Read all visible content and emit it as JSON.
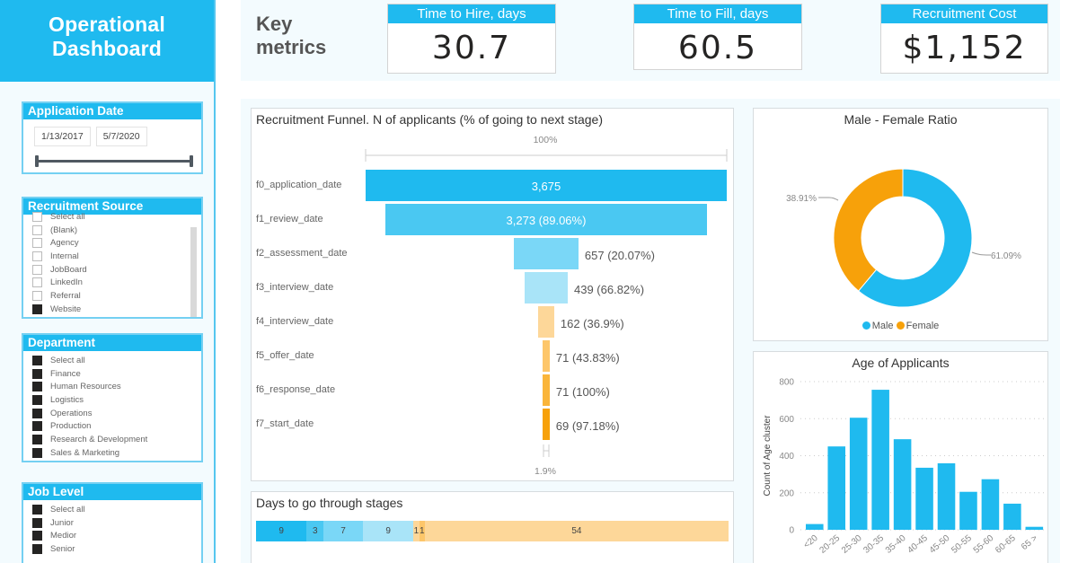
{
  "sidebar": {
    "title_line1": "Operational",
    "title_line2": "Dashboard",
    "application_date": {
      "header": "Application Date",
      "start": "1/13/2017",
      "end": "5/7/2020"
    },
    "recruitment_source": {
      "header": "Recruitment Source",
      "items": [
        {
          "label": "Select all",
          "checked": false
        },
        {
          "label": "(Blank)",
          "checked": false
        },
        {
          "label": "Agency",
          "checked": false
        },
        {
          "label": "Internal",
          "checked": false
        },
        {
          "label": "JobBoard",
          "checked": false
        },
        {
          "label": "LinkedIn",
          "checked": false
        },
        {
          "label": "Referral",
          "checked": false
        },
        {
          "label": "Website",
          "checked": true
        }
      ]
    },
    "department": {
      "header": "Department",
      "items": [
        {
          "label": "Select all",
          "checked": true
        },
        {
          "label": "Finance",
          "checked": true
        },
        {
          "label": "Human Resources",
          "checked": true
        },
        {
          "label": "Logistics",
          "checked": true
        },
        {
          "label": "Operations",
          "checked": true
        },
        {
          "label": "Production",
          "checked": true
        },
        {
          "label": "Research & Development",
          "checked": true
        },
        {
          "label": "Sales & Marketing",
          "checked": true
        }
      ]
    },
    "job_level": {
      "header": "Job Level",
      "items": [
        {
          "label": "Select all",
          "checked": true
        },
        {
          "label": "Junior",
          "checked": true
        },
        {
          "label": "Medior",
          "checked": true
        },
        {
          "label": "Senior",
          "checked": true
        }
      ]
    }
  },
  "key_metrics": {
    "label_line1": "Key",
    "label_line2": "metrics",
    "cards": [
      {
        "title": "Time to Hire, days",
        "value": "30.7"
      },
      {
        "title": "Time to Fill, days",
        "value": "60.5"
      },
      {
        "title": "Recruitment Cost",
        "value": "$1,152"
      }
    ]
  },
  "colors": {
    "accent": "#1fbaef",
    "female": "#f7a10a",
    "funnel": [
      "#1fbaef",
      "#4ac8f2",
      "#7ad7f7",
      "#a9e4f8",
      "#fdd799",
      "#fdc66a",
      "#fab53a",
      "#f7a10a"
    ]
  },
  "chart_data": [
    {
      "type": "bar",
      "subtype": "funnel",
      "title": "Recruitment Funnel. N of applicants (% of going to next stage)",
      "top_axis_label": "100%",
      "bottom_axis_label": "1.9%",
      "categories": [
        "f0_application_date",
        "f1_review_date",
        "f2_assessment_date",
        "f3_interview_date",
        "f4_interview_date",
        "f5_offer_date",
        "f6_response_date",
        "f7_start_date"
      ],
      "values": [
        3675,
        3273,
        657,
        439,
        162,
        71,
        71,
        69
      ],
      "data_labels": [
        "3,675",
        "3,273 (89.06%)",
        "657 (20.07%)",
        "439 (66.82%)",
        "162 (36.9%)",
        "71 (43.83%)",
        "71 (100%)",
        "69 (97.18%)"
      ]
    },
    {
      "type": "bar",
      "subtype": "stacked-100",
      "title": "Days to go through stages",
      "values": [
        9,
        3,
        7,
        9,
        1,
        1,
        54
      ],
      "data_labels": [
        "9",
        "3",
        "7",
        "9",
        "1",
        "1",
        "54"
      ]
    },
    {
      "type": "pie",
      "subtype": "donut",
      "title": "Male - Female Ratio",
      "categories": [
        "Male",
        "Female"
      ],
      "values": [
        61.09,
        38.91
      ],
      "data_labels": [
        "61.09%",
        "38.91%"
      ],
      "legend": "bottom"
    },
    {
      "type": "bar",
      "title": "Age of Applicants",
      "xlabel": "",
      "ylabel": "Count of Age cluster",
      "categories": [
        "<20",
        "20-25",
        "25-30",
        "30-35",
        "35-40",
        "40-45",
        "45-50",
        "50-55",
        "55-60",
        "60-65",
        "65 >"
      ],
      "values": [
        31,
        450,
        605,
        756,
        489,
        335,
        359,
        205,
        273,
        141,
        16
      ],
      "ylim": [
        0,
        800
      ],
      "yticks": [
        "0",
        "200",
        "400",
        "600",
        "800"
      ],
      "grid": true
    }
  ]
}
